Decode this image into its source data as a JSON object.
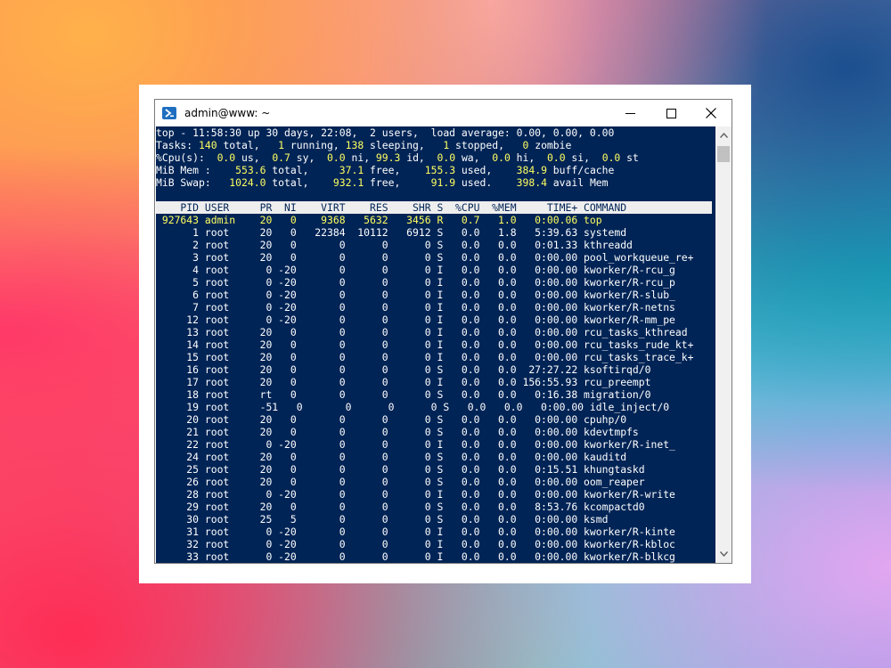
{
  "window": {
    "title": "admin@www: ~",
    "icon": "powershell-icon"
  },
  "summary": {
    "line1": [
      {
        "t": "top - 11:58:30 up 30 days, 22:08,  2 users,  load average: 0.00, 0.00, 0.00",
        "c": "w"
      }
    ],
    "line2": [
      {
        "t": "Tasks: ",
        "c": "w"
      },
      {
        "t": "140",
        "c": "y"
      },
      {
        "t": " total,   ",
        "c": "w"
      },
      {
        "t": "1",
        "c": "y"
      },
      {
        "t": " running, ",
        "c": "w"
      },
      {
        "t": "138",
        "c": "y"
      },
      {
        "t": " sleeping,   ",
        "c": "w"
      },
      {
        "t": "1",
        "c": "y"
      },
      {
        "t": " stopped,   ",
        "c": "w"
      },
      {
        "t": "0",
        "c": "y"
      },
      {
        "t": " zombie",
        "c": "w"
      }
    ],
    "line3": [
      {
        "t": "%Cpu(s):  ",
        "c": "w"
      },
      {
        "t": "0.0",
        "c": "y"
      },
      {
        "t": " us,  ",
        "c": "w"
      },
      {
        "t": "0.7",
        "c": "y"
      },
      {
        "t": " sy,  ",
        "c": "w"
      },
      {
        "t": "0.0",
        "c": "y"
      },
      {
        "t": " ni, ",
        "c": "w"
      },
      {
        "t": "99.3",
        "c": "y"
      },
      {
        "t": " id,  ",
        "c": "w"
      },
      {
        "t": "0.0",
        "c": "y"
      },
      {
        "t": " wa,  ",
        "c": "w"
      },
      {
        "t": "0.0",
        "c": "y"
      },
      {
        "t": " hi,  ",
        "c": "w"
      },
      {
        "t": "0.0",
        "c": "y"
      },
      {
        "t": " si,  ",
        "c": "w"
      },
      {
        "t": "0.0",
        "c": "y"
      },
      {
        "t": " st",
        "c": "w"
      }
    ],
    "line4": [
      {
        "t": "MiB Mem :    ",
        "c": "w"
      },
      {
        "t": "553.6",
        "c": "y"
      },
      {
        "t": " total,     ",
        "c": "w"
      },
      {
        "t": "37.1",
        "c": "y"
      },
      {
        "t": " free,    ",
        "c": "w"
      },
      {
        "t": "155.3",
        "c": "y"
      },
      {
        "t": " used,    ",
        "c": "w"
      },
      {
        "t": "384.9",
        "c": "y"
      },
      {
        "t": " buff/cache",
        "c": "w"
      }
    ],
    "line5": [
      {
        "t": "MiB Swap:   ",
        "c": "w"
      },
      {
        "t": "1024.0",
        "c": "y"
      },
      {
        "t": " total,    ",
        "c": "w"
      },
      {
        "t": "932.1",
        "c": "y"
      },
      {
        "t": " free,     ",
        "c": "w"
      },
      {
        "t": "91.9",
        "c": "y"
      },
      {
        "t": " used.    ",
        "c": "w"
      },
      {
        "t": "398.4",
        "c": "y"
      },
      {
        "t": " avail Mem",
        "c": "w"
      }
    ]
  },
  "table": {
    "columns": [
      "PID",
      "USER",
      "PR",
      "NI",
      "VIRT",
      "RES",
      "SHR",
      "S",
      "%CPU",
      "%MEM",
      "TIME+",
      "COMMAND"
    ],
    "rows": [
      [
        "927643",
        "admin",
        "20",
        "0",
        "9368",
        "5632",
        "3456",
        "R",
        "0.7",
        "1.0",
        "0:00.06",
        "top"
      ],
      [
        "1",
        "root",
        "20",
        "0",
        "22384",
        "10112",
        "6912",
        "S",
        "0.0",
        "1.8",
        "5:39.63",
        "systemd"
      ],
      [
        "2",
        "root",
        "20",
        "0",
        "0",
        "0",
        "0",
        "S",
        "0.0",
        "0.0",
        "0:01.33",
        "kthreadd"
      ],
      [
        "3",
        "root",
        "20",
        "0",
        "0",
        "0",
        "0",
        "S",
        "0.0",
        "0.0",
        "0:00.00",
        "pool_workqueue_re+"
      ],
      [
        "4",
        "root",
        "0",
        "-20",
        "0",
        "0",
        "0",
        "I",
        "0.0",
        "0.0",
        "0:00.00",
        "kworker/R-rcu_g"
      ],
      [
        "5",
        "root",
        "0",
        "-20",
        "0",
        "0",
        "0",
        "I",
        "0.0",
        "0.0",
        "0:00.00",
        "kworker/R-rcu_p"
      ],
      [
        "6",
        "root",
        "0",
        "-20",
        "0",
        "0",
        "0",
        "I",
        "0.0",
        "0.0",
        "0:00.00",
        "kworker/R-slub_"
      ],
      [
        "7",
        "root",
        "0",
        "-20",
        "0",
        "0",
        "0",
        "I",
        "0.0",
        "0.0",
        "0:00.00",
        "kworker/R-netns"
      ],
      [
        "12",
        "root",
        "0",
        "-20",
        "0",
        "0",
        "0",
        "I",
        "0.0",
        "0.0",
        "0:00.00",
        "kworker/R-mm_pe"
      ],
      [
        "13",
        "root",
        "20",
        "0",
        "0",
        "0",
        "0",
        "I",
        "0.0",
        "0.0",
        "0:00.00",
        "rcu_tasks_kthread"
      ],
      [
        "14",
        "root",
        "20",
        "0",
        "0",
        "0",
        "0",
        "I",
        "0.0",
        "0.0",
        "0:00.00",
        "rcu_tasks_rude_kt+"
      ],
      [
        "15",
        "root",
        "20",
        "0",
        "0",
        "0",
        "0",
        "I",
        "0.0",
        "0.0",
        "0:00.00",
        "rcu_tasks_trace_k+"
      ],
      [
        "16",
        "root",
        "20",
        "0",
        "0",
        "0",
        "0",
        "S",
        "0.0",
        "0.0",
        "27:27.22",
        "ksoftirqd/0"
      ],
      [
        "17",
        "root",
        "20",
        "0",
        "0",
        "0",
        "0",
        "I",
        "0.0",
        "0.0",
        "156:55.93",
        "rcu_preempt"
      ],
      [
        "18",
        "root",
        "rt",
        "0",
        "0",
        "0",
        "0",
        "S",
        "0.0",
        "0.0",
        "0:16.38",
        "migration/0"
      ],
      [
        "19",
        "root",
        "-51",
        "0",
        "0",
        "0",
        "0",
        "S",
        "0.0",
        "0.0",
        "0:00.00",
        "idle_inject/0"
      ],
      [
        "20",
        "root",
        "20",
        "0",
        "0",
        "0",
        "0",
        "S",
        "0.0",
        "0.0",
        "0:00.00",
        "cpuhp/0"
      ],
      [
        "21",
        "root",
        "20",
        "0",
        "0",
        "0",
        "0",
        "S",
        "0.0",
        "0.0",
        "0:00.00",
        "kdevtmpfs"
      ],
      [
        "22",
        "root",
        "0",
        "-20",
        "0",
        "0",
        "0",
        "I",
        "0.0",
        "0.0",
        "0:00.00",
        "kworker/R-inet_"
      ],
      [
        "24",
        "root",
        "20",
        "0",
        "0",
        "0",
        "0",
        "S",
        "0.0",
        "0.0",
        "0:00.00",
        "kauditd"
      ],
      [
        "25",
        "root",
        "20",
        "0",
        "0",
        "0",
        "0",
        "S",
        "0.0",
        "0.0",
        "0:15.51",
        "khungtaskd"
      ],
      [
        "26",
        "root",
        "20",
        "0",
        "0",
        "0",
        "0",
        "S",
        "0.0",
        "0.0",
        "0:00.00",
        "oom_reaper"
      ],
      [
        "28",
        "root",
        "0",
        "-20",
        "0",
        "0",
        "0",
        "I",
        "0.0",
        "0.0",
        "0:00.00",
        "kworker/R-write"
      ],
      [
        "29",
        "root",
        "20",
        "0",
        "0",
        "0",
        "0",
        "S",
        "0.0",
        "0.0",
        "8:53.76",
        "kcompactd0"
      ],
      [
        "30",
        "root",
        "25",
        "5",
        "0",
        "0",
        "0",
        "S",
        "0.0",
        "0.0",
        "0:00.00",
        "ksmd"
      ],
      [
        "31",
        "root",
        "0",
        "-20",
        "0",
        "0",
        "0",
        "I",
        "0.0",
        "0.0",
        "0:00.00",
        "kworker/R-kinte"
      ],
      [
        "32",
        "root",
        "0",
        "-20",
        "0",
        "0",
        "0",
        "I",
        "0.0",
        "0.0",
        "0:00.00",
        "kworker/R-kbloc"
      ],
      [
        "33",
        "root",
        "0",
        "-20",
        "0",
        "0",
        "0",
        "I",
        "0.0",
        "0.0",
        "0:00.00",
        "kworker/R-blkcg"
      ]
    ]
  },
  "colors": {
    "terminal_bg": "#012456",
    "highlight": "#ffff5f",
    "text": "#ffffff"
  }
}
